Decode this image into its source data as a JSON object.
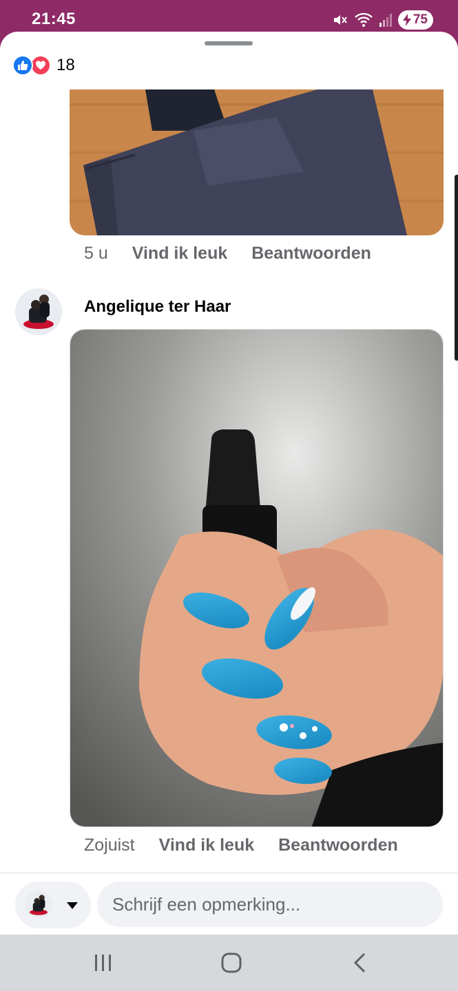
{
  "status_bar": {
    "time": "21:45",
    "battery": "75",
    "icons": [
      "mute-icon",
      "wifi-icon",
      "signal-icon",
      "charging-icon"
    ]
  },
  "reactions": {
    "types": [
      "like-icon",
      "love-icon"
    ],
    "count": "18"
  },
  "comments": [
    {
      "author": "",
      "image": "dark-fabric-pouch-on-wooden-table",
      "time": "5 u",
      "like_label": "Vind ik leuk",
      "reply_label": "Beantwoorden"
    },
    {
      "author": "Angelique ter Haar",
      "image": "hand-with-blue-glitter-nails-holding-cuticle-oil-bottle",
      "time": "Zojuist",
      "like_label": "Vind ik leuk",
      "reply_label": "Beantwoorden"
    }
  ],
  "composer": {
    "placeholder": "Schrijf een opmerking..."
  },
  "colors": {
    "status_bar_bg": "#8e2a66",
    "like_blue": "#1877f2",
    "love_red": "#f33e58",
    "secondary_text": "#65676b",
    "input_bg": "#f0f2f5",
    "nav_bg": "#d7d8dc"
  },
  "nav_bar": {
    "buttons": [
      "recents-icon",
      "home-icon",
      "back-icon"
    ]
  }
}
